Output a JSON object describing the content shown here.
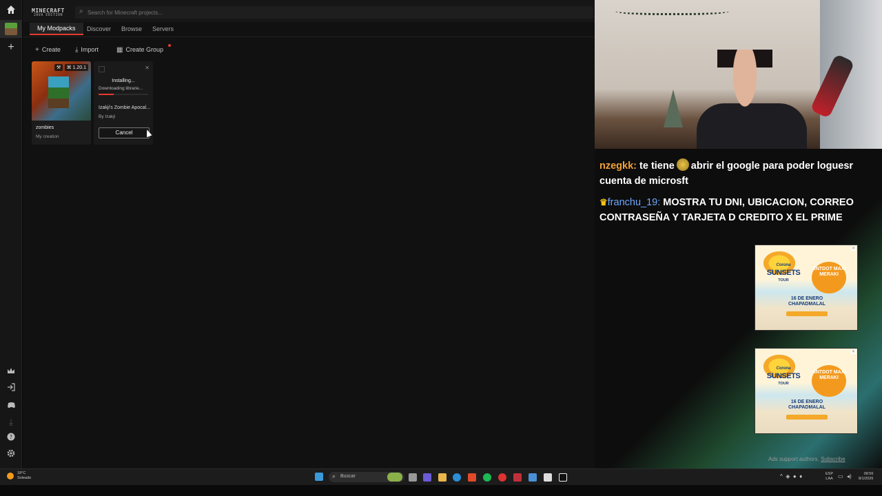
{
  "app": {
    "logo_line1": "MINECRAFT",
    "logo_line2": "JAVA EDITION",
    "search_placeholder": "Search for Minecraft projects...",
    "tabs": [
      {
        "label": "My Modpacks",
        "active": true
      },
      {
        "label": "Discover"
      },
      {
        "label": "Browse"
      },
      {
        "label": "Servers"
      }
    ],
    "actions": {
      "create": "Create",
      "import": "Import",
      "create_group": "Create Group"
    },
    "rail_icons": [
      "home-icon",
      "minecraft-icon",
      "plus-icon",
      "crown-icon",
      "login-icon",
      "discord-icon",
      "download-icon",
      "help-icon",
      "gear-icon"
    ]
  },
  "cards": [
    {
      "name": "zombies",
      "subtitle": "My creation",
      "version": "1.20.1"
    },
    {
      "status": "Installing...",
      "detail": "Downloading librarie...",
      "progress": 0.3,
      "name": "Izakji's Zombie Apocal...",
      "author": "By Izakji",
      "cancel_label": "Cancel"
    }
  ],
  "overlay": {
    "chat": [
      {
        "user": "nzegkk:",
        "text_before": "te tiene",
        "text_after": "abrir el google para poder loguesr cuenta de microsft",
        "user_color": "#f2a23a"
      },
      {
        "user": "franchu_19:",
        "text": "MOSTRA TU DNI, UBICACION, CORREO CONTRASEÑA Y TARJETA D CREDITO X EL PRIME",
        "user_color": "#6fa8ff"
      }
    ],
    "ad": {
      "brand": "Corona",
      "title": "SUNSETS",
      "tour": "TOUR",
      "artist": "ANTDOT MAXI MERAKI",
      "date_line1": "16 DE ENERO",
      "date_line2": "CHAPADMALAL"
    },
    "ads_footer": "Ads support authors.",
    "ads_subscribe": "Subscribe"
  },
  "taskbar": {
    "weather_temp": "18°C",
    "weather_desc": "Soleado",
    "search_label": "Buscar",
    "lang_top": "ESP",
    "lang_bottom": "LAA",
    "time": "08:56",
    "date": "8/1/2026"
  },
  "colors": {
    "accent": "#e63b2e",
    "panel": "#111111",
    "rail": "#161616"
  }
}
